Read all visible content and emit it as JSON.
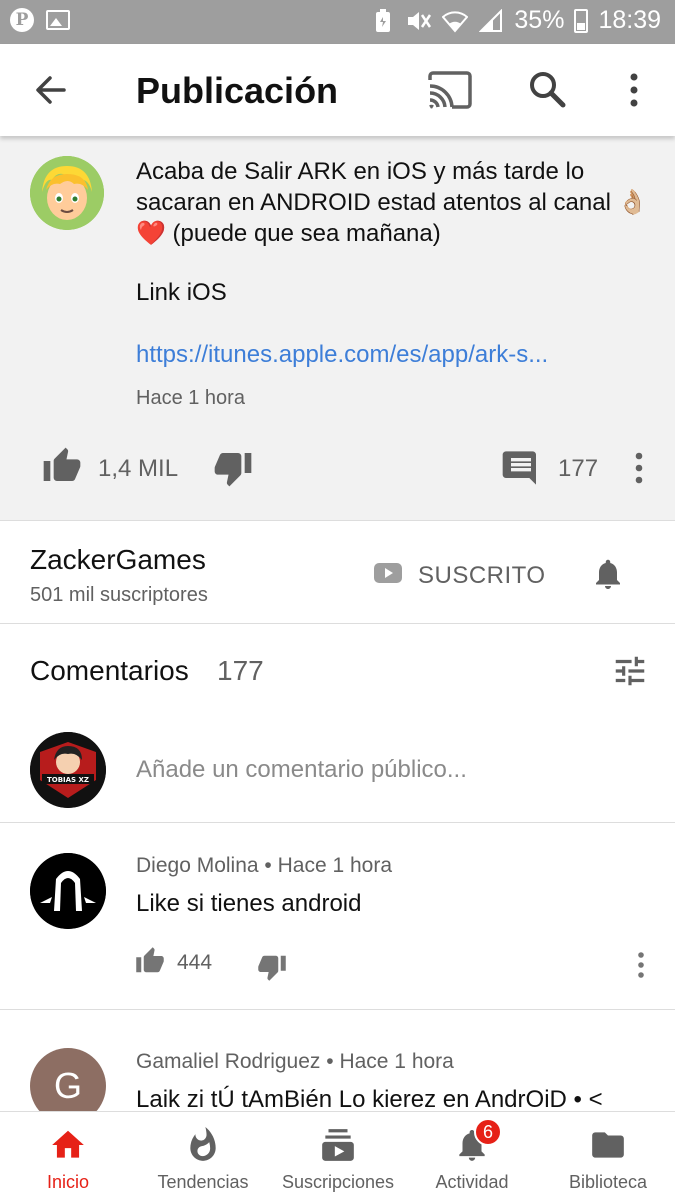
{
  "status_bar": {
    "battery": "35%",
    "time": "18:39",
    "battery_level": 0.35
  },
  "app_bar": {
    "title": "Publicación"
  },
  "post": {
    "text_lines": [
      "Acaba de Salir ARK en iOS y más tarde lo sacaran en ANDROID estad atentos al canal 👌🏼❤️ (puede que sea mañana)",
      "Link iOS"
    ],
    "link": "https://itunes.apple.com/es/app/ark-s...",
    "time": "Hace 1 hora",
    "likes": "1,4 MIL",
    "comments": "177"
  },
  "channel": {
    "name": "ZackerGames",
    "subscribers": "501 mil suscriptores",
    "subscribe_label": "SUSCRITO"
  },
  "comments": {
    "title": "Comentarios",
    "count": "177",
    "placeholder": "Añade un comentario público...",
    "my_avatar_text": "TOBIAS XZ",
    "items": [
      {
        "author": "Diego Molina",
        "time": "Hace 1 hora",
        "text": "Like si tienes android",
        "likes": "444"
      },
      {
        "author": "Gamaliel Rodriguez",
        "time": "Hace 1 hora",
        "text": "Laik zi tÚ tAmBién Lo kierez en AndrOiD • <",
        "avatar_letter": "G"
      }
    ]
  },
  "bottom_nav": {
    "items": [
      {
        "label": "Inicio",
        "icon": "home-icon"
      },
      {
        "label": "Tendencias",
        "icon": "flame-icon"
      },
      {
        "label": "Suscripciones",
        "icon": "subscriptions-icon"
      },
      {
        "label": "Actividad",
        "icon": "bell-icon",
        "badge": "6"
      },
      {
        "label": "Biblioteca",
        "icon": "folder-icon"
      }
    ]
  },
  "colors": {
    "accent": "#e62117",
    "link": "#3d7ed8",
    "status_bar": "#9e9e9e",
    "post_bg": "#f2f2f2"
  }
}
